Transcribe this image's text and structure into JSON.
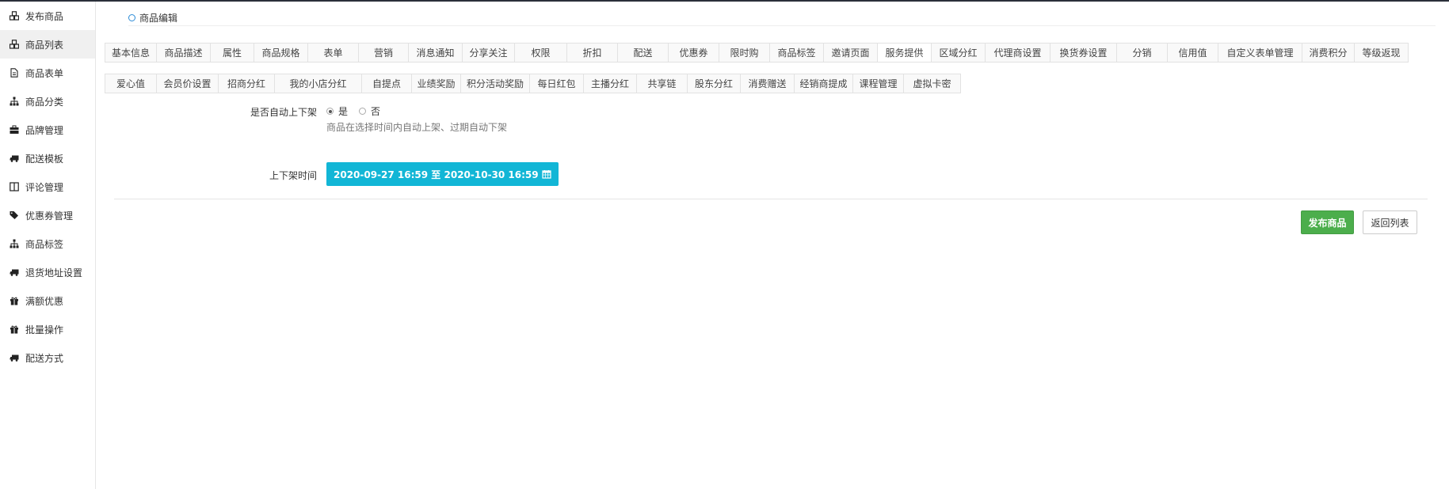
{
  "sidebar": {
    "items": [
      {
        "label": "发布商品",
        "icon": "cubes-icon",
        "active": false
      },
      {
        "label": "商品列表",
        "icon": "cubes-icon",
        "active": true
      },
      {
        "label": "商品表单",
        "icon": "file-icon",
        "active": false
      },
      {
        "label": "商品分类",
        "icon": "sitemap-icon",
        "active": false
      },
      {
        "label": "品牌管理",
        "icon": "briefcase-icon",
        "active": false
      },
      {
        "label": "配送模板",
        "icon": "truck-icon",
        "active": false
      },
      {
        "label": "评论管理",
        "icon": "columns-icon",
        "active": false
      },
      {
        "label": "优惠券管理",
        "icon": "tags-icon",
        "active": false
      },
      {
        "label": "商品标签",
        "icon": "sitemap-icon",
        "active": false
      },
      {
        "label": "退货地址设置",
        "icon": "truck-icon",
        "active": false
      },
      {
        "label": "满额优惠",
        "icon": "gift-icon",
        "active": false
      },
      {
        "label": "批量操作",
        "icon": "gift-icon",
        "active": false
      },
      {
        "label": "配送方式",
        "icon": "truck-icon",
        "active": false
      }
    ]
  },
  "page": {
    "title": "商品编辑"
  },
  "tabs": {
    "row1": [
      "基本信息",
      "商品描述",
      "属性",
      "商品规格",
      "表单",
      "营销",
      "消息通知",
      "分享关注",
      "权限",
      "折扣",
      "配送",
      "优惠券",
      "限时购",
      "商品标签",
      "邀请页面",
      "服务提供",
      "区域分红",
      "代理商设置",
      "换货券设置",
      "分销",
      "信用值",
      "自定义表单管理",
      "消费积分",
      "等级返现"
    ],
    "row2": [
      "爱心值",
      "会员价设置",
      "招商分红",
      "我的小店分红",
      "自提点",
      "业绩奖励",
      "积分活动奖励",
      "每日红包",
      "主播分红",
      "共享链",
      "股东分红",
      "消费赠送",
      "经销商提成",
      "课程管理",
      "虚拟卡密"
    ],
    "active": "服务提供"
  },
  "form": {
    "auto_shelf_label": "是否自动上下架",
    "auto_shelf_yes": "是",
    "auto_shelf_no": "否",
    "auto_shelf_value": "是",
    "auto_shelf_help": "商品在选择时间内自动上架、过期自动下架",
    "shelf_time_label": "上下架时间",
    "shelf_time_value": "2020-09-27 16:59 至 2020-10-30 16:59"
  },
  "actions": {
    "publish_label": "发布商品",
    "back_label": "返回列表"
  },
  "colors": {
    "primary_button": "#4cae4c",
    "date_button": "#12b6d6"
  }
}
